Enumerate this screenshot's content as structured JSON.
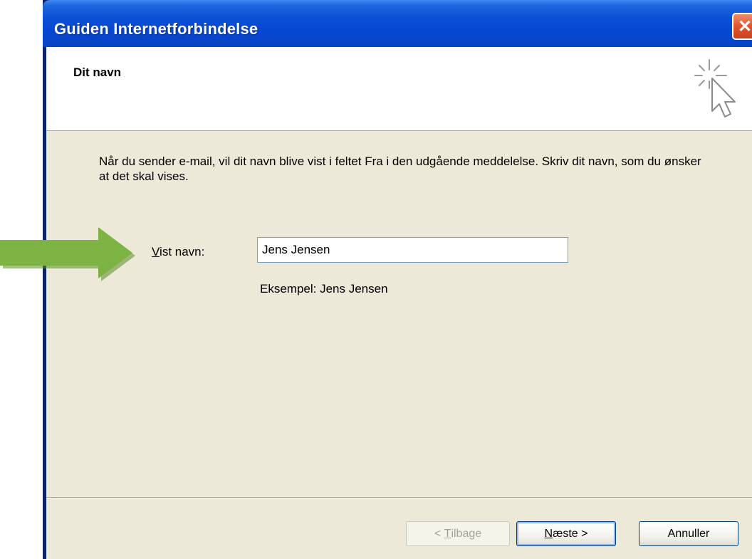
{
  "window": {
    "title": "Guiden Internetforbindelse",
    "close_icon": "close-icon"
  },
  "header": {
    "title": "Dit navn",
    "icon": "wizard-cursor-icon"
  },
  "body": {
    "description": "Når du sender e-mail, vil dit navn blive vist i feltet Fra i den udgående meddelelse. Skriv dit navn, som du ønsker at det skal vises.",
    "field_label_mnemonic": "V",
    "field_label_rest": "ist navn:",
    "field_value": "Jens Jensen",
    "example_text": "Eksempel: Jens Jensen"
  },
  "buttons": {
    "back_prefix": "< ",
    "back_mnemonic": "T",
    "back_rest": "ilbage",
    "next_mnemonic": "N",
    "next_rest": "æste >",
    "cancel": "Annuller"
  },
  "annotation": {
    "arrow_icon": "green-arrow-icon",
    "arrow_color": "#7cb342"
  },
  "colors": {
    "titlebar": "#0646d1",
    "dialog_bg": "#ece9d8",
    "close_button": "#e2552c"
  }
}
